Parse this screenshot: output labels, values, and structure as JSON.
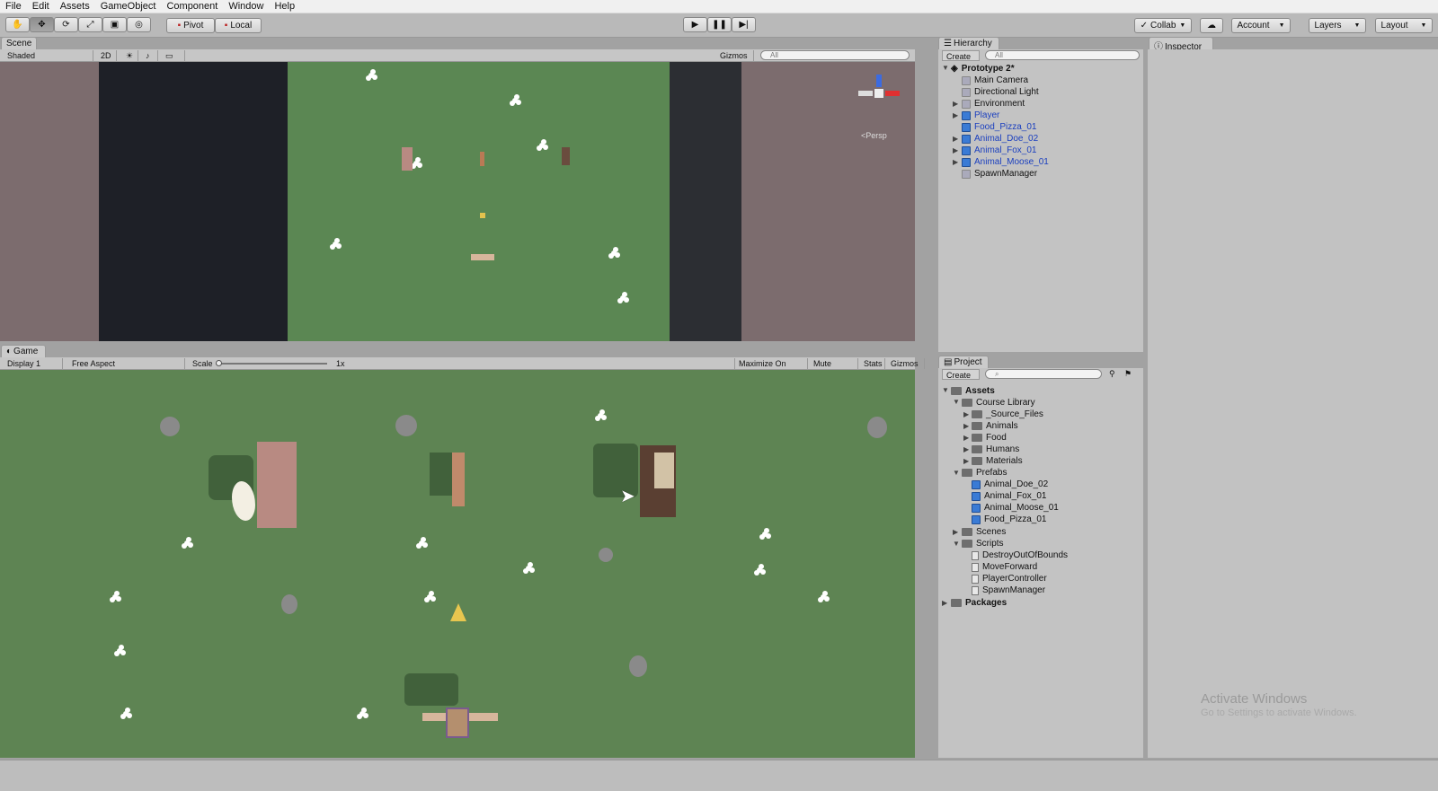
{
  "menu": [
    "File",
    "Edit",
    "Assets",
    "GameObject",
    "Component",
    "Window",
    "Help"
  ],
  "toolbar": {
    "pivot": "Pivot",
    "local": "Local",
    "collab": "Collab",
    "account": "Account",
    "layers": "Layers",
    "layout": "Layout"
  },
  "scene": {
    "tab": "Scene",
    "shading": "Shaded",
    "mode2d": "2D",
    "gizmos": "Gizmos",
    "search": "All",
    "persp": "Persp"
  },
  "game": {
    "tab": "Game",
    "display": "Display 1",
    "aspect": "Free Aspect",
    "scale_label": "Scale",
    "scale_value": "1x",
    "maximize": "Maximize On Play",
    "mute": "Mute Audio",
    "stats": "Stats",
    "gizmos": "Gizmos"
  },
  "hierarchy": {
    "tab": "Hierarchy",
    "create": "Create",
    "search": "All",
    "root": "Prototype 2*",
    "items": [
      "Main Camera",
      "Directional Light",
      "Environment",
      "Player",
      "Food_Pizza_01",
      "Animal_Doe_02",
      "Animal_Fox_01",
      "Animal_Moose_01",
      "SpawnManager"
    ]
  },
  "inspector": {
    "tab": "Inspector"
  },
  "project": {
    "tab": "Project",
    "create": "Create",
    "assets": "Assets",
    "course": "Course Library",
    "course_children": [
      "_Source_Files",
      "Animals",
      "Food",
      "Humans",
      "Materials"
    ],
    "prefabs": "Prefabs",
    "prefab_children": [
      "Animal_Doe_02",
      "Animal_Fox_01",
      "Animal_Moose_01",
      "Food_Pizza_01"
    ],
    "scenes": "Scenes",
    "scripts": "Scripts",
    "script_children": [
      "DestroyOutOfBounds",
      "MoveForward",
      "PlayerController",
      "SpawnManager"
    ],
    "packages": "Packages"
  },
  "watermark": {
    "line1": "Activate Windows",
    "line2": "Go to Settings to activate Windows."
  },
  "colors": {
    "grass": "#5e8453",
    "hierarchy_blue": "#1a3fbf",
    "panel": "#c3c3c3"
  }
}
